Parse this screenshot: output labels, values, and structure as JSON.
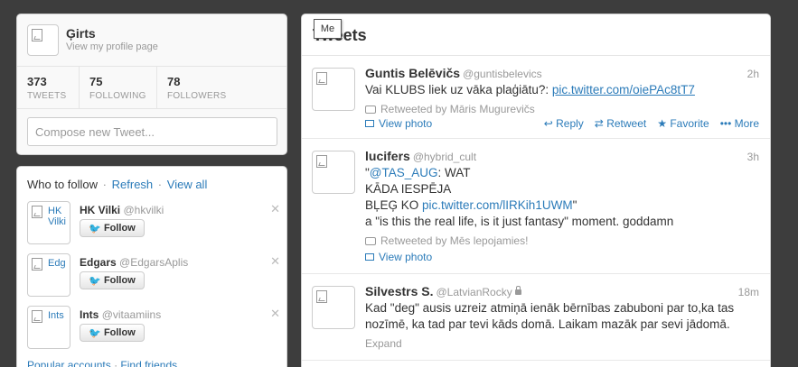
{
  "profile": {
    "name": "Ģirts",
    "profile_link": "View my profile page",
    "stats": [
      {
        "num": "373",
        "label": "TWEETS"
      },
      {
        "num": "75",
        "label": "FOLLOWING"
      },
      {
        "num": "78",
        "label": "FOLLOWERS"
      }
    ],
    "compose_placeholder": "Compose new Tweet..."
  },
  "who_to_follow": {
    "title": "Who to follow",
    "refresh": "Refresh",
    "view_all": "View all",
    "follow_label": "Follow",
    "suggestions": [
      {
        "avatar_text": "HK Vilki",
        "name": "HK Vilki",
        "handle": "@hkvilki"
      },
      {
        "avatar_text": "Edg",
        "name": "Edgars",
        "handle": "@EdgarsAplis"
      },
      {
        "avatar_text": "Ints",
        "name": "Ints",
        "handle": "@vitaamiins"
      }
    ],
    "footer_popular": "Popular accounts",
    "footer_find": "Find friends"
  },
  "tweets_panel": {
    "title": "Tweets",
    "tooltip": "Me"
  },
  "tweets": [
    {
      "name": "Guntis Belēvičs",
      "handle": "@guntisbelevics",
      "time": "2h",
      "text_plain": "Vai KLUBS liek uz vāka plaģiātu?: ",
      "text_link": "pic.twitter.com/oiePAc8tT7",
      "retweeted_by": "Retweeted by Māris Mugurevičs",
      "view_photo": "View photo",
      "actions": {
        "reply": "Reply",
        "retweet": "Retweet",
        "favorite": "Favorite",
        "more": "More"
      }
    },
    {
      "name": "lucifers",
      "handle": "@hybrid_cult",
      "time": "3h",
      "line1_quote": "\"",
      "line1_link": "@TAS_AUG",
      "line1_rest": ": WAT",
      "line2": "KĀDA IESPĒJA",
      "line3_plain": "BĻEĢ KO ",
      "line3_link": "pic.twitter.com/lIRKih1UWM",
      "line3_end": "\"",
      "line4": "a \"is this the real life, is it just fantasy\" moment. goddamn",
      "retweeted_by": "Retweeted by Mēs lepojamies!",
      "view_photo": "View photo"
    },
    {
      "name": "Silvestrs S.",
      "handle": "@LatvianRocky",
      "time": "18m",
      "text": "Kad \"deg\" ausis uzreiz atmiņā ienāk bērnības zabuboni par to,ka tas nozīmē, ka tad par tevi kāds domā. Laikam mazāk par sevi jādomā.",
      "expand": "Expand"
    }
  ]
}
